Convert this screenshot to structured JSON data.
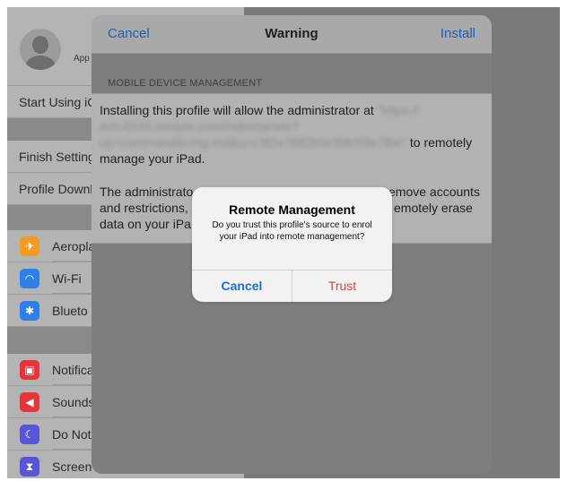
{
  "sidebar": {
    "account_label": "App",
    "start_using": "Start Using iC",
    "finish_setting": "Finish Setting",
    "profile_download": "Profile Downl",
    "items": [
      {
        "label": "Aeropla",
        "icon": "airplane-icon",
        "color": "#f39c25",
        "glyph": "✈"
      },
      {
        "label": "Wi-Fi",
        "icon": "wifi-icon",
        "color": "#2f7fe8",
        "glyph": "◠"
      },
      {
        "label": "Blueto",
        "icon": "bluetooth-icon",
        "color": "#2f7fe8",
        "glyph": "✱"
      },
      {
        "label": "Notifica",
        "icon": "notifications-icon",
        "color": "#e4353a",
        "glyph": "▣"
      },
      {
        "label": "Sounds",
        "icon": "sounds-icon",
        "color": "#e4353a",
        "glyph": "◀"
      },
      {
        "label": "Do Not",
        "icon": "do-not-disturb-icon",
        "color": "#5856d6",
        "glyph": "☾"
      },
      {
        "label": "Screen",
        "icon": "screen-time-icon",
        "color": "#5856d6",
        "glyph": "⧗"
      }
    ]
  },
  "sheet": {
    "cancel_label": "Cancel",
    "title": "Warning",
    "install_label": "Install",
    "section_header": "MOBILE DEVICE MANAGEMENT",
    "para1_prefix": "Installing this profile will allow the administrator at",
    "para1_url_line1": "\"https://",
    "para1_url_line2": "sch-0103.mosyle.com/mdm/server?",
    "para1_url_line3": "op=command&cmg-md&u=c3f2e7f9f2b0e3bb3f9e7fbe\"",
    "para1_suffix": "to remotely",
    "para1_line_last": "manage your iPad.",
    "para2_line1": "The administrato",
    "para2_line1b": "emove accounts",
    "para2_line2": "and restrictions,",
    "para2_line2b": "emotely erase",
    "para2_line3": "data on your iPa"
  },
  "alert": {
    "title": "Remote Management",
    "message": "Do you trust this profile's source to enrol your iPad into remote management?",
    "cancel_label": "Cancel",
    "trust_label": "Trust"
  }
}
